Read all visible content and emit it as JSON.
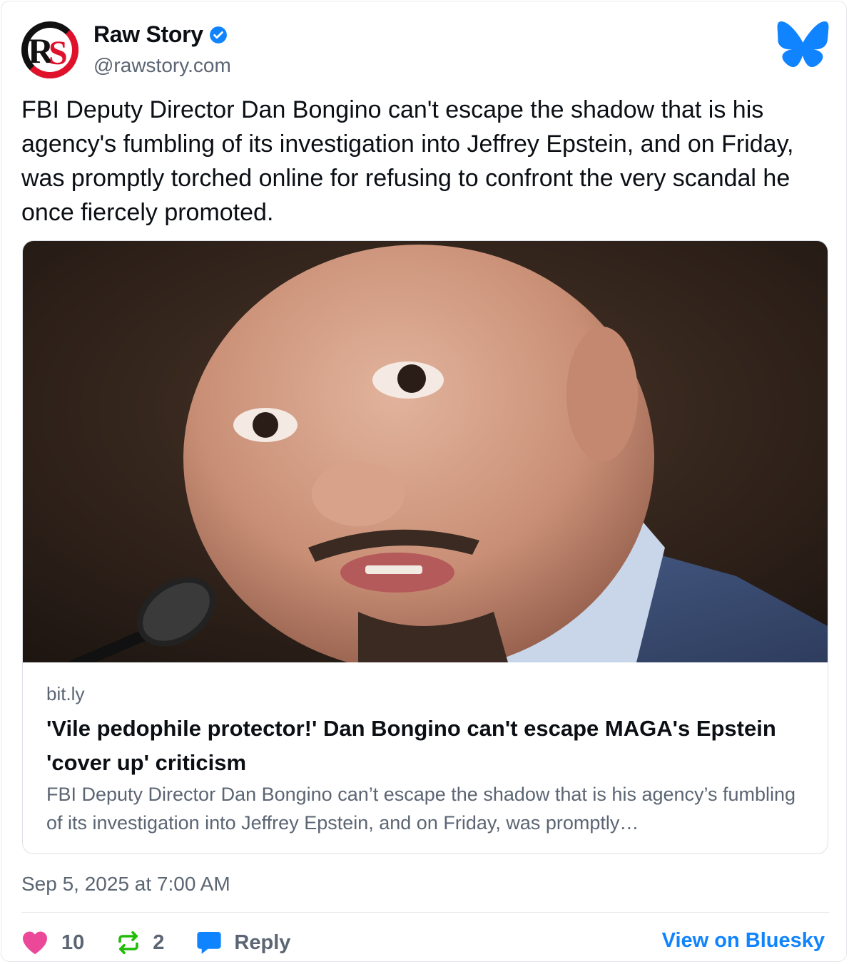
{
  "author": {
    "display_name": "Raw Story",
    "handle": "@rawstory.com",
    "avatar_icon": "raw-story-logo",
    "verified_icon": "verified-badge-icon"
  },
  "platform_icon": "bluesky-butterfly-icon",
  "post": {
    "text": "FBI Deputy Director Dan Bongino can't escape the shadow that is his agency's fumbling of its investigation into Jeffrey Epstein, and on Friday, was promptly torched online for refusing to confront the very scandal he once fiercely promoted."
  },
  "embed": {
    "domain": "bit.ly",
    "title": "'Vile pedophile protector!' Dan Bongino can't escape MAGA's Epstein 'cover up' criticism",
    "description": "FBI Deputy Director Dan Bongino can’t escape the shadow that is his agency’s fumbling of its investigation into Jeffrey Epstein, and on Friday, was promptly…"
  },
  "timestamp": "Sep 5, 2025 at 7:00 AM",
  "actions": {
    "likes": "10",
    "reposts": "2",
    "reply_label": "Reply",
    "view_link": "View on Bluesky"
  },
  "colors": {
    "like": "#ec4899",
    "repost": "#20bc07",
    "reply": "#1083fe",
    "link": "#1083fe",
    "verified": "#1083fe",
    "logo_red": "#e0112b"
  }
}
